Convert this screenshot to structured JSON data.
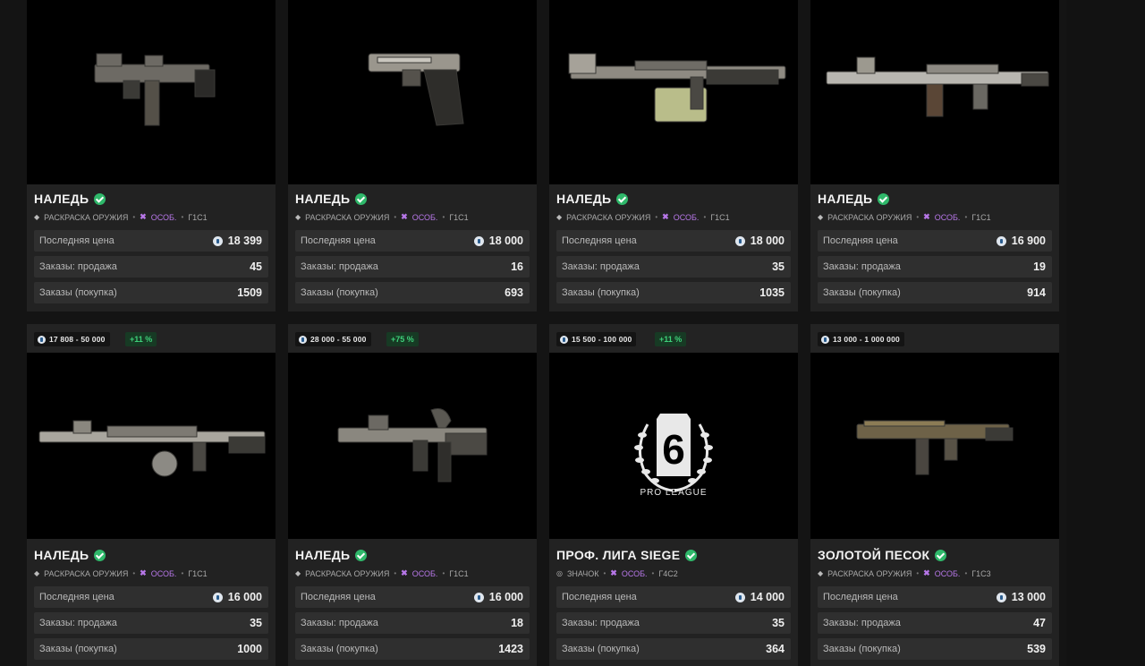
{
  "labels": {
    "last_price": "Последняя цена",
    "orders_sell": "Заказы: продажа",
    "orders_buy": "Заказы (покупка)"
  },
  "cards": [
    {
      "title": "НАЛЕДЬ",
      "type": "РАСКРАСКА ОРУЖИЯ",
      "rarity": "ОСОБ.",
      "code": "Г1С1",
      "price": "18 399",
      "sell": "45",
      "buy": "1509"
    },
    {
      "title": "НАЛЕДЬ",
      "type": "РАСКРАСКА ОРУЖИЯ",
      "rarity": "ОСОБ.",
      "code": "Г1С1",
      "price": "18 000",
      "sell": "16",
      "buy": "693"
    },
    {
      "title": "НАЛЕДЬ",
      "type": "РАСКРАСКА ОРУЖИЯ",
      "rarity": "ОСОБ.",
      "code": "Г1С1",
      "price": "18 000",
      "sell": "35",
      "buy": "1035"
    },
    {
      "title": "НАЛЕДЬ",
      "type": "РАСКРАСКА ОРУЖИЯ",
      "rarity": "ОСОБ.",
      "code": "Г1С1",
      "price": "16 900",
      "sell": "19",
      "buy": "914"
    },
    {
      "range": "17 808 - 50 000",
      "pct": "+11 %",
      "title": "НАЛЕДЬ",
      "type": "РАСКРАСКА ОРУЖИЯ",
      "rarity": "ОСОБ.",
      "code": "Г1С1",
      "price": "16 000",
      "sell": "35",
      "buy": "1000"
    },
    {
      "range": "28 000 - 55 000",
      "pct": "+75 %",
      "title": "НАЛЕДЬ",
      "type": "РАСКРАСКА ОРУЖИЯ",
      "rarity": "ОСОБ.",
      "code": "Г1С1",
      "price": "16 000",
      "sell": "18",
      "buy": "1423"
    },
    {
      "range": "15 500 - 100 000",
      "pct": "+11 %",
      "title": "ПРОФ. ЛИГА SIEGE",
      "type": "ЗНАЧОК",
      "rarity": "ОСОБ.",
      "code": "Г4С2",
      "price": "14 000",
      "sell": "35",
      "buy": "364",
      "logo_text": "PRO LEAGUE"
    },
    {
      "range": "13 000 - 1 000 000",
      "title": "ЗОЛОТОЙ ПЕСОК",
      "type": "РАСКРАСКА ОРУЖИЯ",
      "rarity": "ОСОБ.",
      "code": "Г1С3",
      "price": "13 000",
      "sell": "47",
      "buy": "539"
    }
  ],
  "icons": {
    "currency": "r6-credit-coin-icon",
    "verified": "check-circle-icon",
    "rarity": "rarity-x-icon",
    "type": "tag-icon"
  },
  "colors": {
    "verified": "#2fb86a",
    "rarity": "#b777e8",
    "pct_text": "#3ed07a",
    "accent_bar": "#27b6a0"
  }
}
